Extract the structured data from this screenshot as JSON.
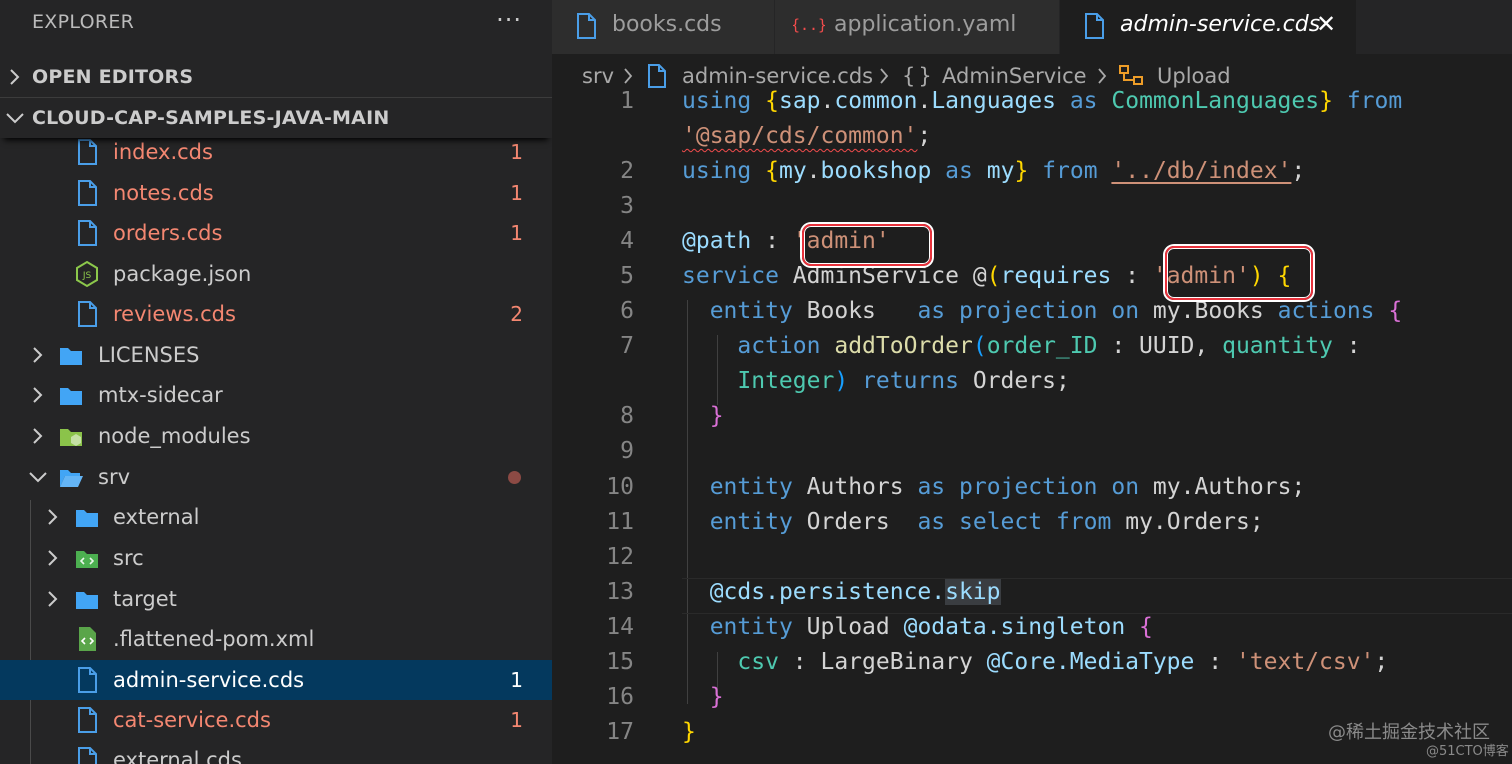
{
  "sidebar": {
    "title": "EXPLORER",
    "more_glyph": "···",
    "open_editors_label": "OPEN EDITORS",
    "project_label": "CLOUD-CAP-SAMPLES-JAVA-MAIN",
    "items": [
      {
        "label": "index.cds",
        "badge": "1"
      },
      {
        "label": "notes.cds",
        "badge": "1"
      },
      {
        "label": "orders.cds",
        "badge": "1"
      },
      {
        "label": "package.json",
        "badge": ""
      },
      {
        "label": "reviews.cds",
        "badge": "2"
      },
      {
        "label": "LICENSES",
        "badge": ""
      },
      {
        "label": "mtx-sidecar",
        "badge": ""
      },
      {
        "label": "node_modules",
        "badge": ""
      },
      {
        "label": "srv",
        "badge": ""
      },
      {
        "label": "external",
        "badge": ""
      },
      {
        "label": "src",
        "badge": ""
      },
      {
        "label": "target",
        "badge": ""
      },
      {
        "label": ".flattened-pom.xml",
        "badge": ""
      },
      {
        "label": "admin-service.cds",
        "badge": "1"
      },
      {
        "label": "cat-service.cds",
        "badge": "1"
      },
      {
        "label": "external.cds",
        "badge": ""
      }
    ]
  },
  "tabs": [
    {
      "label": "books.cds",
      "icon": "file-icon"
    },
    {
      "label": "application.yaml",
      "icon": "yaml-icon"
    },
    {
      "label": "admin-service.cds",
      "icon": "file-icon",
      "close": "✕"
    }
  ],
  "breadcrumb": {
    "folder": "srv",
    "file": "admin-service.cds",
    "service_glyph": "{}",
    "service": "AdminService",
    "entity": "Upload"
  },
  "code": {
    "line_numbers": [
      "1",
      "",
      "2",
      "3",
      "4",
      "5",
      "6",
      "7",
      "",
      "8",
      "9",
      "10",
      "11",
      "12",
      "13",
      "14",
      "15",
      "16",
      "17"
    ],
    "lines": [
      "using {sap.common.Languages as CommonLanguages} from",
      "'@sap/cds/common';",
      "using {my.bookshop as my} from '../db/index';",
      "",
      "@path : 'admin'",
      "service AdminService @(requires : 'admin') {",
      "  entity Books   as projection on my.Books actions {",
      "    action addToOrder(order_ID : UUID, quantity :",
      "    Integer) returns Orders;",
      "  }",
      "",
      "  entity Authors as projection on my.Authors;",
      "  entity Orders  as select from my.Orders;",
      "",
      "  @cds.persistence.skip",
      "  entity Upload @odata.singleton {",
      "    csv : LargeBinary @Core.MediaType : 'text/csv';",
      "  }",
      "}"
    ]
  },
  "watermark": {
    "line1": "@稀土掘金技术社区",
    "line2": "@51CTO博客"
  },
  "colors": {
    "error": "#f48771",
    "selection": "#04395e",
    "keyword": "#569cd6",
    "string": "#ce9178",
    "highlight_box": "#e8323c"
  }
}
